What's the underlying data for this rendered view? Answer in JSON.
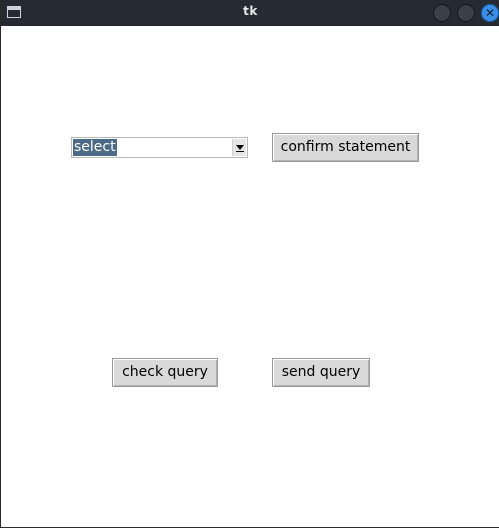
{
  "window": {
    "title": "tk",
    "close_glyph": "✕"
  },
  "icons": {
    "app": "window-icon",
    "minimize": "minimize-circle-icon",
    "maximize": "maximize-circle-icon",
    "close": "close-icon",
    "dropdown": "chevron-down-icon"
  },
  "colors": {
    "titlebar": "#262a33",
    "close_button": "#3b8ee8",
    "selection": "#4a6a85",
    "button_face": "#d9d9d9"
  },
  "statement_select": {
    "value": "select"
  },
  "buttons": {
    "confirm_statement": "confirm statement",
    "check_query": "check query",
    "send_query": "send query"
  }
}
